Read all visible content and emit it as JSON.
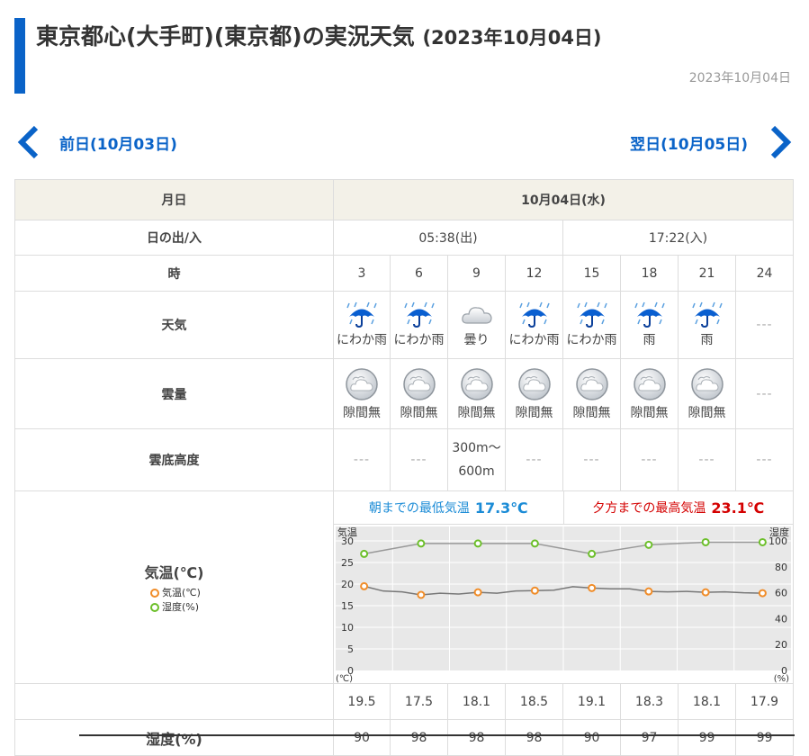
{
  "page": {
    "title_main": "東京都心(大手町)(東京都)の実況天気",
    "title_date": "(2023年10月04日)",
    "updated": "2023年10月04日"
  },
  "nav": {
    "prev_label": "前日(10月03日)",
    "next_label": "翌日(10月05日)"
  },
  "table": {
    "date_header": "月日",
    "date_value": "10月04日(水)",
    "sun_header": "日の出/入",
    "sunrise": "05:38(出)",
    "sunset": "17:22(入)",
    "hour_header": "時",
    "hours": [
      "3",
      "6",
      "9",
      "12",
      "15",
      "18",
      "21",
      "24"
    ],
    "weather_header": "天気",
    "weather": [
      {
        "label": "にわか雨",
        "icon": "umbrella-rain-icon"
      },
      {
        "label": "にわか雨",
        "icon": "umbrella-rain-icon"
      },
      {
        "label": "曇り",
        "icon": "cloud-icon"
      },
      {
        "label": "にわか雨",
        "icon": "umbrella-rain-icon"
      },
      {
        "label": "にわか雨",
        "icon": "umbrella-rain-icon"
      },
      {
        "label": "雨",
        "icon": "umbrella-rain-icon"
      },
      {
        "label": "雨",
        "icon": "umbrella-rain-icon"
      },
      {
        "label": "---",
        "icon": ""
      }
    ],
    "cloud_header": "雲量",
    "cloud": [
      "隙間無",
      "隙間無",
      "隙間無",
      "隙間無",
      "隙間無",
      "隙間無",
      "隙間無",
      "---"
    ],
    "ceiling_header": "雲底高度",
    "ceiling": [
      "---",
      "---",
      "300m～600m",
      "---",
      "---",
      "---",
      "---",
      "---"
    ],
    "temp_header": "気温(℃)",
    "legend_temp": "気温(℃)",
    "legend_hum": "湿度(%)",
    "min_label": "朝までの最低気温",
    "min_value": "17.3℃",
    "max_label": "夕方までの最高気温",
    "max_value": "23.1℃",
    "temps": [
      "19.5",
      "17.5",
      "18.1",
      "18.5",
      "19.1",
      "18.3",
      "18.1",
      "17.9"
    ],
    "hum_header": "湿度(%)",
    "humidity": [
      "90",
      "98",
      "98",
      "98",
      "90",
      "97",
      "99",
      "99"
    ]
  },
  "chart_data": {
    "type": "line",
    "y_left_label": "気温",
    "y_right_label": "湿度",
    "y_left_unit": "(℃)",
    "y_right_unit": "(%)",
    "y_left_ticks": [
      "30",
      "25",
      "20",
      "15",
      "10",
      "5",
      "0"
    ],
    "y_right_ticks": [
      "100",
      "80",
      "60",
      "40",
      "20",
      "0"
    ],
    "ylim_left": [
      0,
      30
    ],
    "ylim_right": [
      0,
      100
    ],
    "x": [
      3,
      6,
      9,
      12,
      15,
      18,
      21,
      24
    ],
    "series": [
      {
        "name": "気温(℃)",
        "axis": "left",
        "color": "#f08c28",
        "values": [
          19.5,
          17.5,
          18.1,
          18.5,
          19.1,
          18.3,
          18.1,
          17.9
        ]
      },
      {
        "name": "湿度(%)",
        "axis": "right",
        "color": "#6cbf2a",
        "values": [
          90,
          98,
          98,
          98,
          90,
          97,
          99,
          99
        ]
      }
    ],
    "temp_minor": [
      [
        4,
        18.4
      ],
      [
        5,
        18.2
      ],
      [
        7,
        17.9
      ],
      [
        8,
        17.7
      ],
      [
        10,
        17.9
      ],
      [
        11,
        18.4
      ],
      [
        13,
        18.6
      ],
      [
        14,
        19.4
      ],
      [
        16,
        18.9
      ],
      [
        17,
        18.9
      ],
      [
        19,
        18.2
      ],
      [
        20,
        18.3
      ],
      [
        22,
        18.2
      ],
      [
        23,
        18.0
      ]
    ],
    "grid": true,
    "colors": {
      "grid_bg": "#e8e8e8",
      "grid_line": "#ffffff",
      "temp_line": "#777777",
      "hum_line": "#999999"
    }
  }
}
